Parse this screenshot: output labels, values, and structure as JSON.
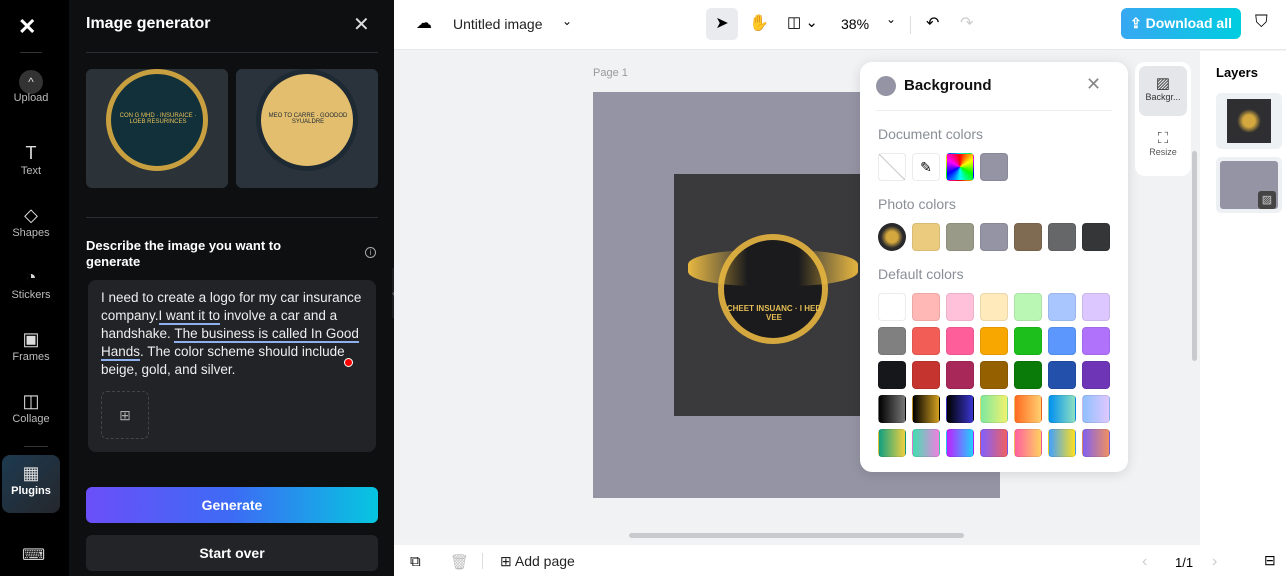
{
  "rail": {
    "items": [
      {
        "label": "Upload",
        "icon": "upload-icon"
      },
      {
        "label": "Text",
        "icon": "text-icon"
      },
      {
        "label": "Shapes",
        "icon": "shapes-icon"
      },
      {
        "label": "Stickers",
        "icon": "stickers-icon"
      },
      {
        "label": "Frames",
        "icon": "frames-icon"
      },
      {
        "label": "Collage",
        "icon": "collage-icon"
      },
      {
        "label": "Plugins",
        "icon": "plugins-icon"
      }
    ]
  },
  "panel": {
    "title": "Image generator",
    "describe_label": "Describe the image you want to generate",
    "thumb_texts": [
      "CON G MHD · INSURAICE · LOEB RESURINCES",
      "MEO TO CARRE · GOODOD SYUALDRE"
    ],
    "prompt_parts": [
      "I need to create a logo for my car insurance company.",
      "I want it to",
      " involve a car and a handshake.",
      "The business is called In Good Hands",
      ". The color scheme should include beige, gold, and silver."
    ],
    "generate": "Generate",
    "start_over": "Start over"
  },
  "topbar": {
    "title": "Untitled image",
    "zoom": "38%",
    "download": "Download all"
  },
  "canvas": {
    "page_label": "Page 1",
    "page_color": "#9594a4",
    "logo_text": "CHEET INSUANC · I HED VEE"
  },
  "bg_panel": {
    "title": "Background",
    "document_colors_label": "Document colors",
    "photo_colors_label": "Photo colors",
    "default_colors_label": "Default colors",
    "document_colors": [
      "#9594a4"
    ],
    "photo_colors": [
      "#ebcb7e",
      "#9a9a88",
      "#9594a4",
      "#7f6b52",
      "#666769",
      "#353638"
    ],
    "default_colors": [
      [
        "#ffffff",
        "#ffb8b5",
        "#ffc0da",
        "#ffeabb",
        "#baf7b5",
        "#a9c6ff",
        "#dcc7fe"
      ],
      [
        "#808080",
        "#f25d56",
        "#fe5f9b",
        "#f8a600",
        "#1cbf1b",
        "#5b97fc",
        "#b072fb"
      ],
      [
        "#16171b",
        "#c5342f",
        "#a8285a",
        "#946000",
        "#0a7a08",
        "#2350ab",
        "#6e36b7"
      ],
      [
        "linear-gradient(90deg,#000,#777)",
        "linear-gradient(90deg,#000,#d4a020)",
        "linear-gradient(90deg,#000,#3a36d0)",
        "linear-gradient(90deg,#7fe8a0,#f1f26d)",
        "linear-gradient(90deg,#ff6a20,#ffd070)",
        "linear-gradient(90deg,#0090f0,#8fe0c0)",
        "linear-gradient(90deg,#8fc0ff,#e0c8ff)"
      ],
      [
        "linear-gradient(90deg,#10a080,#f0d040)",
        "linear-gradient(90deg,#40e0b0,#f080e0)",
        "linear-gradient(90deg,#c020ff,#20d0ff)",
        "linear-gradient(90deg,#8060ff,#f06060)",
        "linear-gradient(90deg,#ff60a0,#ffd060)",
        "linear-gradient(90deg,#40a0ff,#ffe020)",
        "linear-gradient(90deg,#8060f0,#f09060)"
      ]
    ]
  },
  "side_tools": {
    "background": "Backgr...",
    "resize": "Resize"
  },
  "layers": {
    "title": "Layers"
  },
  "bottombar": {
    "add_page": "Add page",
    "page_count": "1/1"
  }
}
